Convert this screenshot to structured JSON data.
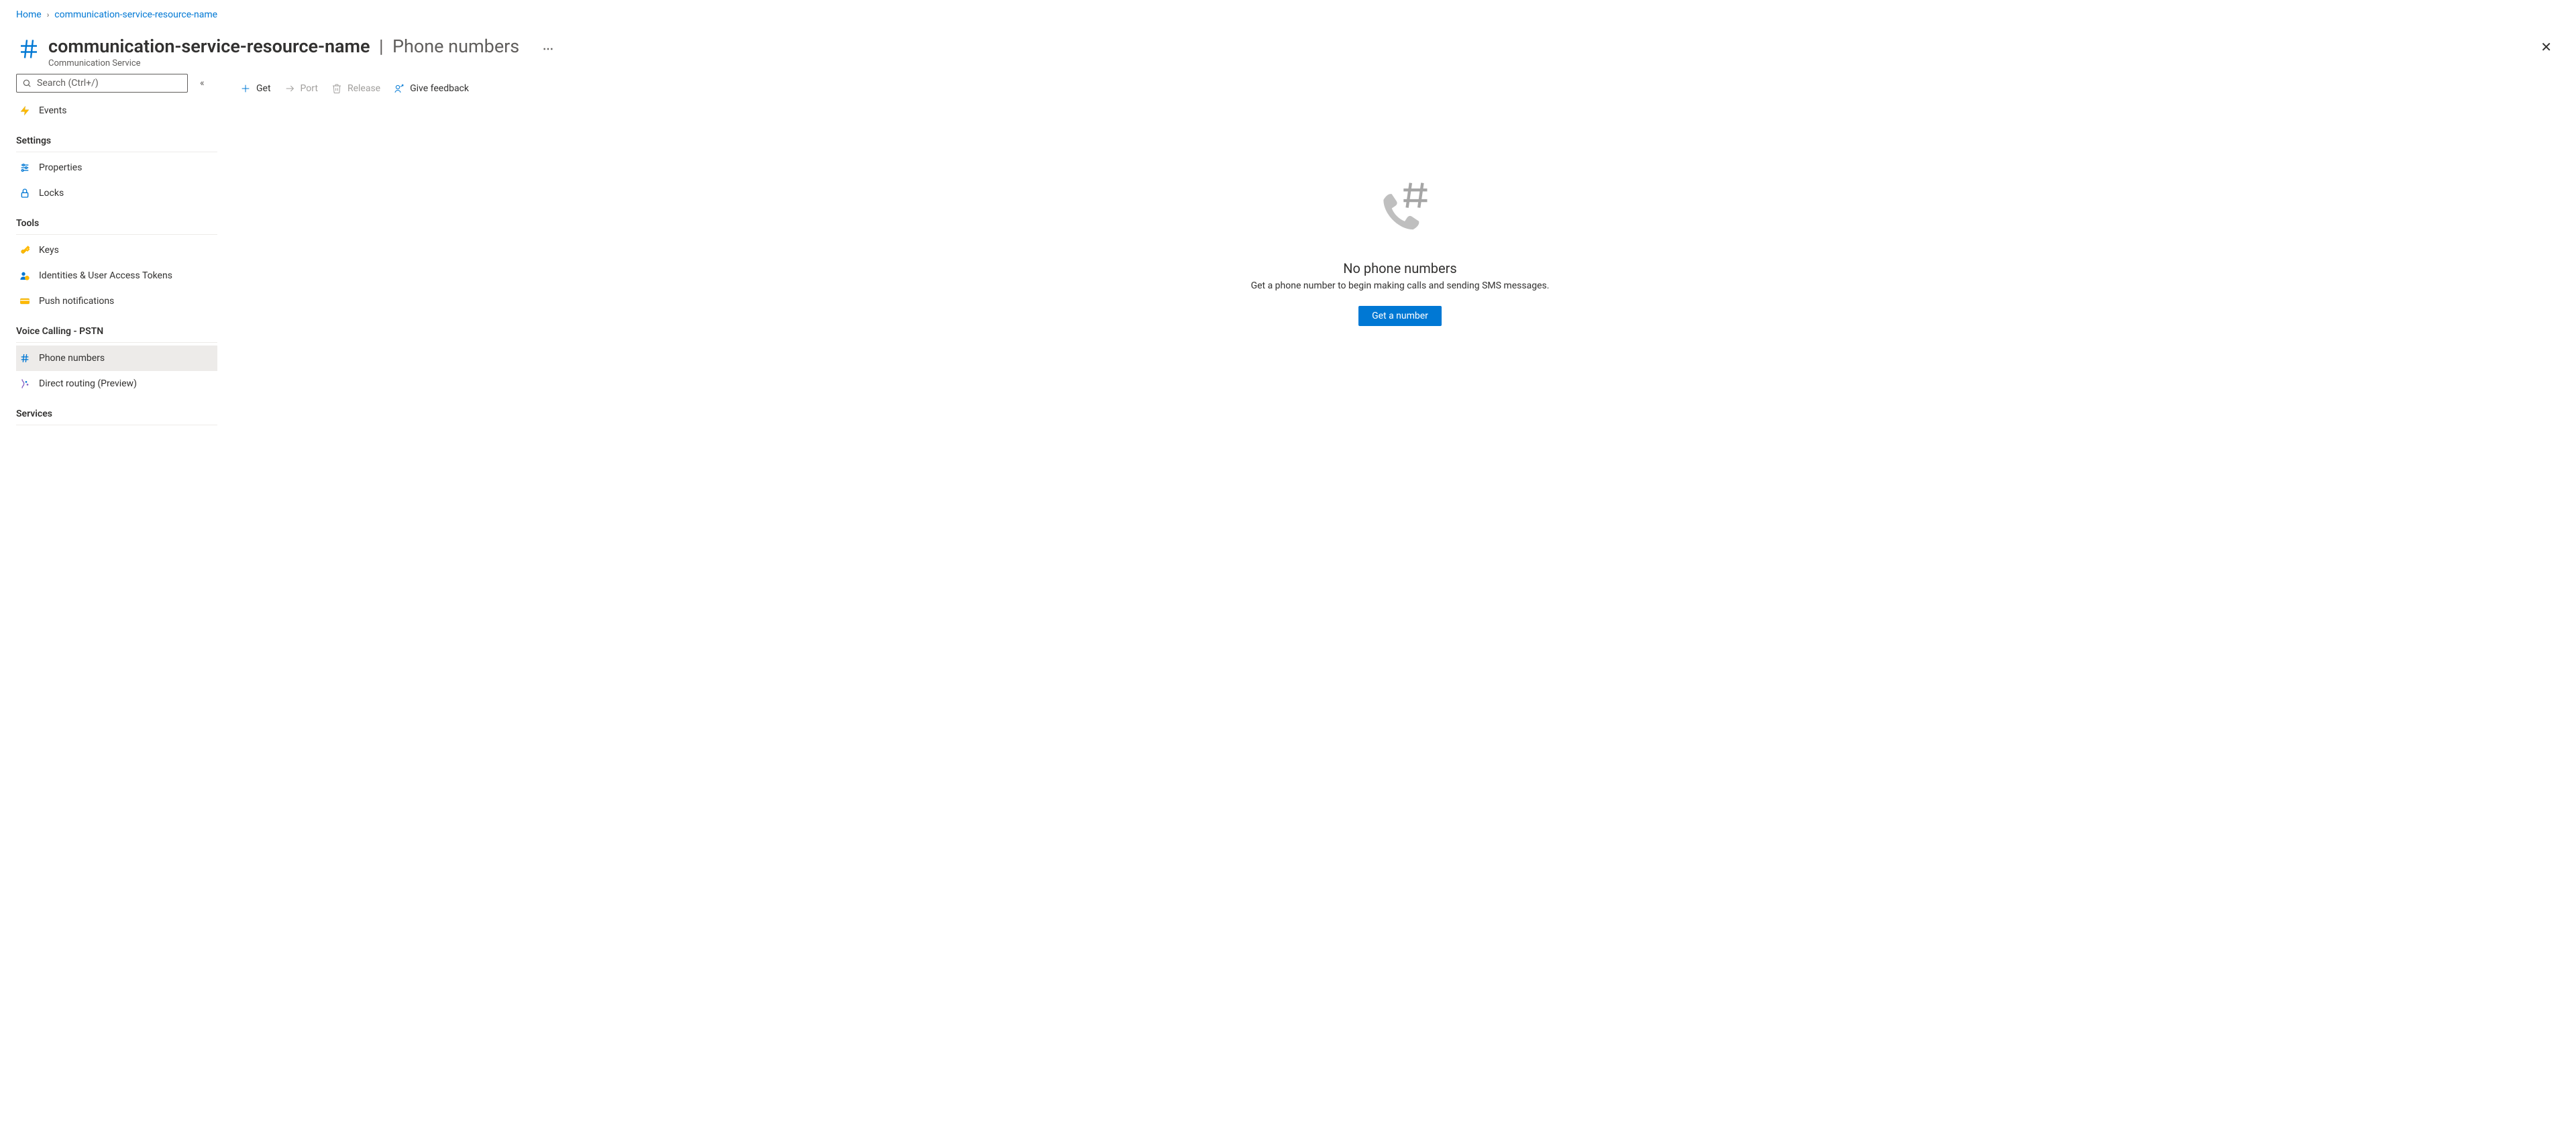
{
  "breadcrumb": {
    "home": "Home",
    "resource": "communication-service-resource-name"
  },
  "header": {
    "resource_name": "communication-service-resource-name",
    "separator": "|",
    "section": "Phone numbers",
    "subtitle": "Communication Service"
  },
  "sidebar": {
    "search_placeholder": "Search (Ctrl+/)",
    "events": "Events",
    "group_settings": "Settings",
    "properties": "Properties",
    "locks": "Locks",
    "group_tools": "Tools",
    "keys": "Keys",
    "identities": "Identities & User Access Tokens",
    "push": "Push notifications",
    "group_voice": "Voice Calling - PSTN",
    "phone_numbers": "Phone numbers",
    "direct_routing": "Direct routing (Preview)",
    "group_services": "Services"
  },
  "toolbar": {
    "get": "Get",
    "port": "Port",
    "release": "Release",
    "feedback": "Give feedback"
  },
  "empty": {
    "title": "No phone numbers",
    "desc": "Get a phone number to begin making calls and sending SMS messages.",
    "cta": "Get a number"
  }
}
